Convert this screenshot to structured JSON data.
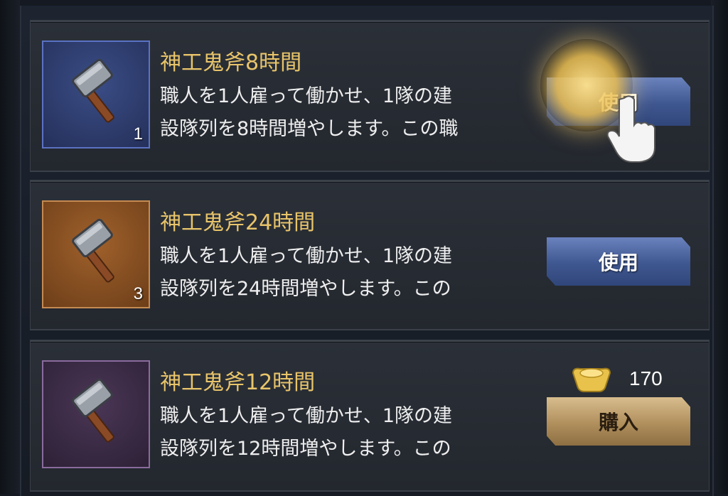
{
  "items": [
    {
      "title": "神工鬼斧8時間",
      "desc_line1": "職人を1人雇って働かせ、1隊の建",
      "desc_line2": "設隊列を8時間増やします。この職",
      "count": "1",
      "action_label": "使用",
      "rarity_color": "#5b72c3"
    },
    {
      "title": "神工鬼斧24時間",
      "desc_line1": "職人を1人雇って働かせ、1隊の建",
      "desc_line2": "設隊列を24時間増やします。この",
      "count": "3",
      "action_label": "使用",
      "rarity_color": "#c48a52"
    },
    {
      "title": "神工鬼斧12時間",
      "desc_line1": "職人を1人雇って働かせ、1隊の建",
      "desc_line2": "設隊列を12時間増やします。この",
      "count": "",
      "action_label": "購入",
      "price": "170",
      "price_icon": "gold-ingot-icon",
      "rarity_color": "#8a6b9e"
    }
  ],
  "icons": {
    "item": "hammer-icon",
    "tutorial_pointer": "pointing-hand-icon"
  }
}
